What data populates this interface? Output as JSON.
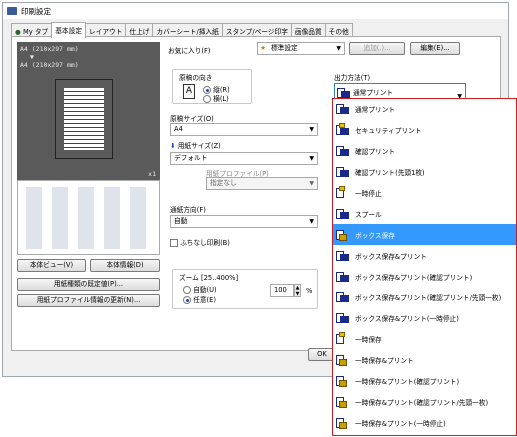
{
  "window": {
    "title": "印刷設定"
  },
  "tabs": [
    {
      "label": "My タブ"
    },
    {
      "label": "基本設定"
    },
    {
      "label": "レイアウト"
    },
    {
      "label": "仕上げ"
    },
    {
      "label": "カバーシート/挿入紙"
    },
    {
      "label": "スタンプ/ページ印字"
    },
    {
      "label": "画像品質"
    },
    {
      "label": "その他"
    }
  ],
  "preview": {
    "size1": "A4 (210x297 mm)",
    "size2": "A4 (210x297 mm)",
    "copies": "x1"
  },
  "left_buttons": {
    "view": "本体ビュー(V)",
    "info": "本体情報(D)",
    "paper_type": "用紙種類の既定値(P)...",
    "paper_profile": "用紙プロファイル情報の更新(N)..."
  },
  "favorites": {
    "label": "お気に入り(F)",
    "value": "標準設定",
    "add": "追加(.)...",
    "edit": "編集(E)..."
  },
  "orientation": {
    "label": "原稿の向き",
    "portrait": "縦(R)",
    "landscape": "横(L)"
  },
  "original_size": {
    "label": "原稿サイズ(O)",
    "value": "A4"
  },
  "paper_size": {
    "label": "用紙サイズ(Z)",
    "value": "デフォルト"
  },
  "paper_profile": {
    "label": "用紙プロファイル(P)",
    "value": "指定なし"
  },
  "feed": {
    "label": "通紙方向(F)",
    "value": "自動"
  },
  "borderless": {
    "label": "ふちなし印刷(B)"
  },
  "zoom": {
    "label": "ズーム [25..400%]",
    "auto": "自動(U)",
    "arbitrary": "任意(E)",
    "value": "100",
    "unit": "%"
  },
  "output": {
    "label": "出力方法(T)",
    "value": "通常プリント"
  },
  "dialog": {
    "ok": "OK"
  },
  "options": [
    {
      "label": "通常プリント",
      "icon": "print-icon"
    },
    {
      "label": "セキュリティプリント",
      "icon": "secure-print-icon"
    },
    {
      "label": "確認プリント",
      "icon": "proof-print-icon"
    },
    {
      "label": "確認プリント(先頭1枚)",
      "icon": "proof-print-icon"
    },
    {
      "label": "一時停止",
      "icon": "pause-icon"
    },
    {
      "label": "スプール",
      "icon": "spool-icon"
    },
    {
      "label": "ボックス保存",
      "icon": "box-icon"
    },
    {
      "label": "ボックス保存&プリント",
      "icon": "box-print-icon"
    },
    {
      "label": "ボックス保存&プリント(確認プリント)",
      "icon": "box-print-icon"
    },
    {
      "label": "ボックス保存&プリント(確認プリント/先頭一枚)",
      "icon": "box-print-icon"
    },
    {
      "label": "ボックス保存&プリント(一時停止)",
      "icon": "box-print-icon"
    },
    {
      "label": "一時保存",
      "icon": "temp-save-icon"
    },
    {
      "label": "一時保存&プリント",
      "icon": "temp-save-print-icon"
    },
    {
      "label": "一時保存&プリント(確認プリント)",
      "icon": "temp-save-print-icon"
    },
    {
      "label": "一時保存&プリント(確認プリント/先頭一枚)",
      "icon": "temp-save-print-icon"
    },
    {
      "label": "一時保存&プリント(一時停止)",
      "icon": "temp-save-print-icon"
    }
  ],
  "highlighted_option": "ボックス保存",
  "colors": {
    "highlight": "#3399ff",
    "dropdown_border": "#cf1d1d"
  }
}
